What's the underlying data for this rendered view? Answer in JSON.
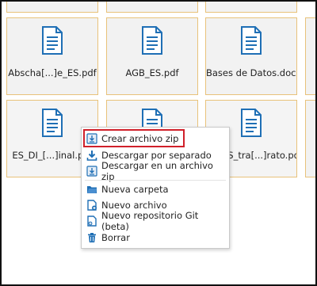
{
  "files": [
    {
      "name": "Abscha[...]e_ES.pdf"
    },
    {
      "name": "AGB_ES.pdf"
    },
    {
      "name": "Bases de Datos.docx"
    },
    {
      "name": "ES_DI_[...]inal.pdf"
    },
    {
      "name": ""
    },
    {
      "name": "ES_tra[...]rato.pdf"
    }
  ],
  "context_menu": {
    "items": [
      {
        "label": "Crear archivo zip",
        "icon": "zip-icon"
      },
      {
        "label": "Descargar por separado",
        "icon": "download-icon"
      },
      {
        "label": "Descargar en un archivo zip",
        "icon": "download-zip-icon"
      },
      {
        "label": "Nueva carpeta",
        "icon": "new-folder-icon"
      },
      {
        "label": "Nuevo archivo",
        "icon": "new-file-icon"
      },
      {
        "label": "Nuevo repositorio Git (beta)",
        "icon": "git-icon"
      },
      {
        "label": "Borrar",
        "icon": "trash-icon"
      }
    ]
  },
  "colors": {
    "accent": "#1f6fb5",
    "highlight_border": "#d0202a",
    "tile_border": "#e8c27a"
  }
}
